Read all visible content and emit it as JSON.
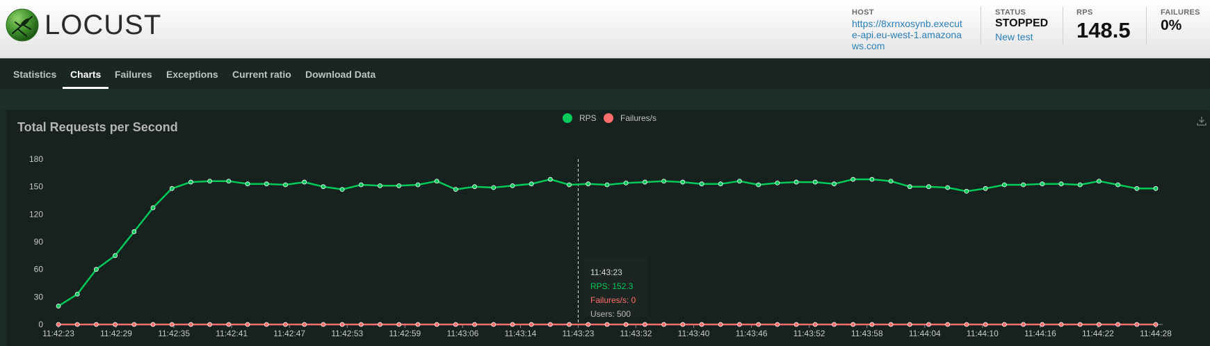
{
  "header": {
    "logo_text": "LOCUST",
    "host_label": "HOST",
    "host_value": "https://8xrnxosynb.execute-api.eu-west-1.amazonaws.com",
    "status_label": "STATUS",
    "status_value": "STOPPED",
    "new_test_label": "New test",
    "rps_label": "RPS",
    "rps_value": "148.5",
    "failures_label": "FAILURES",
    "failures_value": "0%"
  },
  "tabs": [
    {
      "label": "Statistics",
      "active": false
    },
    {
      "label": "Charts",
      "active": true
    },
    {
      "label": "Failures",
      "active": false
    },
    {
      "label": "Exceptions",
      "active": false
    },
    {
      "label": "Current ratio",
      "active": false
    },
    {
      "label": "Download Data",
      "active": false
    }
  ],
  "colors": {
    "rps": "#00ca5a",
    "failures": "#ff6d6d"
  },
  "tooltip": {
    "time": "11:43:23",
    "rps": "RPS: 152.3",
    "failures": "Failures/s: 0",
    "users": "Users: 500"
  },
  "chart_data": {
    "type": "line",
    "title": "Total Requests per Second",
    "legend": [
      "RPS",
      "Failures/s"
    ],
    "legend_position": "top-center",
    "ylim": [
      0,
      180
    ],
    "y_ticks": [
      0,
      30,
      60,
      90,
      120,
      150,
      180
    ],
    "x_tick_labels": [
      "11:42:23",
      "11:42:29",
      "11:42:35",
      "11:42:41",
      "11:42:47",
      "11:42:53",
      "11:42:59",
      "11:43:06",
      "11:43:14",
      "11:43:23",
      "11:43:32",
      "11:43:40",
      "11:43:46",
      "11:43:52",
      "11:43:58",
      "11:44:04",
      "11:44:10",
      "11:44:16",
      "11:44:22",
      "11:44:28"
    ],
    "series": [
      {
        "name": "RPS",
        "values": [
          20,
          33,
          60,
          75,
          101,
          127,
          148,
          155,
          156,
          156,
          153,
          153,
          152,
          155,
          150,
          147,
          152,
          151,
          151,
          152,
          156,
          147,
          150,
          149,
          151,
          153,
          158,
          152,
          153,
          152,
          154,
          155,
          156,
          155,
          153,
          153,
          156,
          152,
          154,
          155,
          155,
          153,
          158,
          158,
          156,
          150,
          150,
          149,
          145,
          148,
          152,
          152,
          153,
          153,
          152,
          156,
          152,
          148,
          148
        ]
      },
      {
        "name": "Failures/s",
        "values": [
          0,
          0,
          0,
          0,
          0,
          0,
          0,
          0,
          0,
          0,
          0,
          0,
          0,
          0,
          0,
          0,
          0,
          0,
          0,
          0,
          0,
          0,
          0,
          0,
          0,
          0,
          0,
          0,
          0,
          0,
          0,
          0,
          0,
          0,
          0,
          0,
          0,
          0,
          0,
          0,
          0,
          0,
          0,
          0,
          0,
          0,
          0,
          0,
          0,
          0,
          0,
          0,
          0,
          0,
          0,
          0,
          0,
          0,
          0
        ]
      }
    ],
    "hover_time": "11:43:23"
  }
}
